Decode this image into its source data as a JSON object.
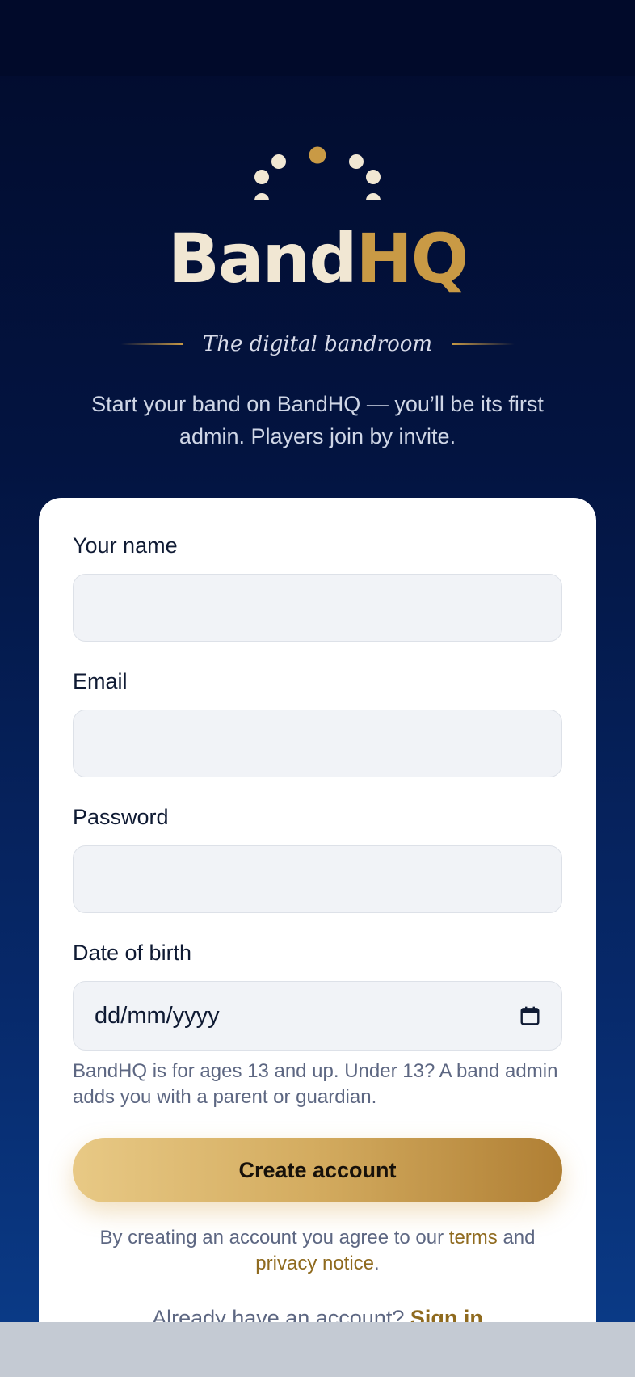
{
  "brand": {
    "name_part1": "Band",
    "name_part2": "HQ",
    "tagline": "The digital bandroom",
    "colors": {
      "cream": "#f1e7d3",
      "gold": "#c99a45",
      "navy": "#031441"
    }
  },
  "intro": "Start your band on BandHQ — you’ll be its first admin. Players join by invite.",
  "form": {
    "name_label": "Your name",
    "name_value": "",
    "email_label": "Email",
    "email_value": "",
    "password_label": "Password",
    "password_value": "",
    "dob_label": "Date of birth",
    "dob_placeholder": "dd/mm/yyyy",
    "dob_icon": "calendar-icon",
    "age_hint": "BandHQ is for ages 13 and up. Under 13? A band admin adds you with a parent or guardian.",
    "submit_label": "Create account"
  },
  "legal": {
    "prefix": "By creating an account you agree to our ",
    "terms_link": "terms",
    "middle": " and ",
    "privacy_link": "privacy notice",
    "suffix": "."
  },
  "signin": {
    "prompt": "Already have an account? ",
    "link": "Sign in"
  }
}
